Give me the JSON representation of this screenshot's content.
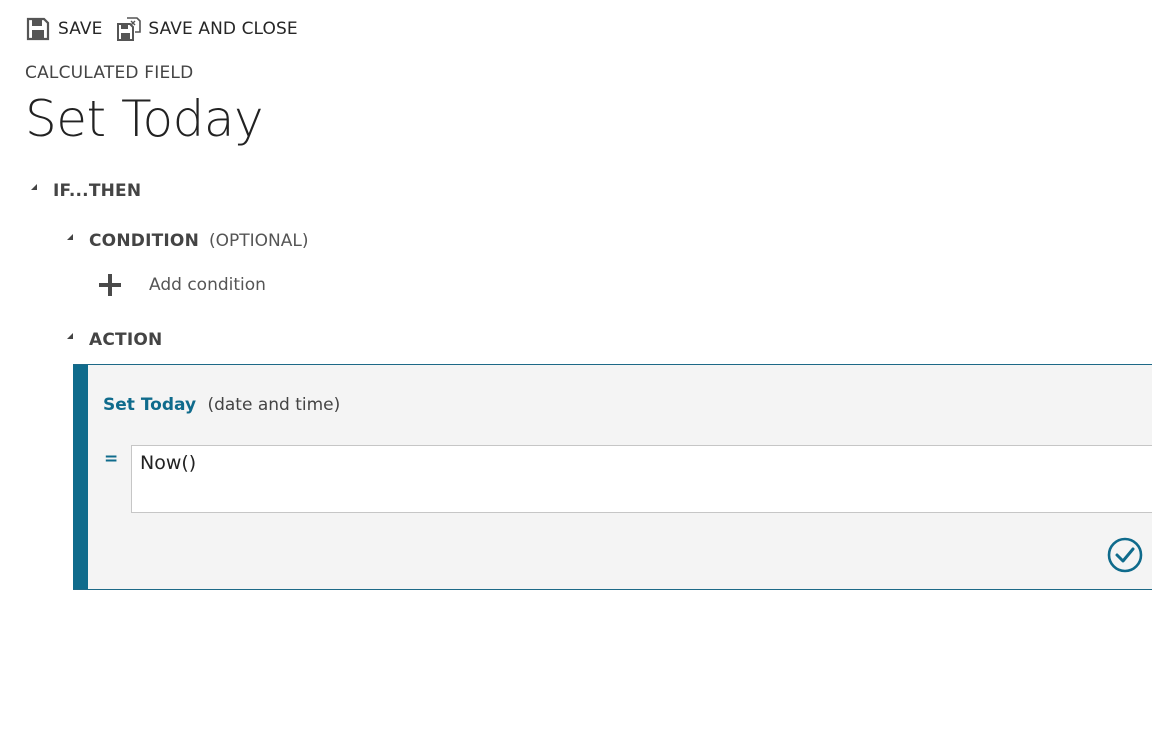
{
  "toolbar": {
    "save_label": "SAVE",
    "save_close_label": "SAVE AND CLOSE"
  },
  "entity_label": "CALCULATED FIELD",
  "title": "Set Today",
  "tree": {
    "ifthen_label": "IF...THEN",
    "condition_label": "CONDITION",
    "condition_sub": "(OPTIONAL)",
    "add_condition_label": "Add condition",
    "action_label": "ACTION"
  },
  "action": {
    "field_name": "Set Today",
    "field_type": "(date and time)",
    "equals": "=",
    "formula": "Now()"
  },
  "colors": {
    "accent": "#0f6b8c",
    "panel_bg": "#f4f4f4"
  },
  "icons": [
    "save-icon",
    "save-and-close-icon",
    "collapse-triangle-icon",
    "plus-icon",
    "checkmark-circle-icon"
  ]
}
